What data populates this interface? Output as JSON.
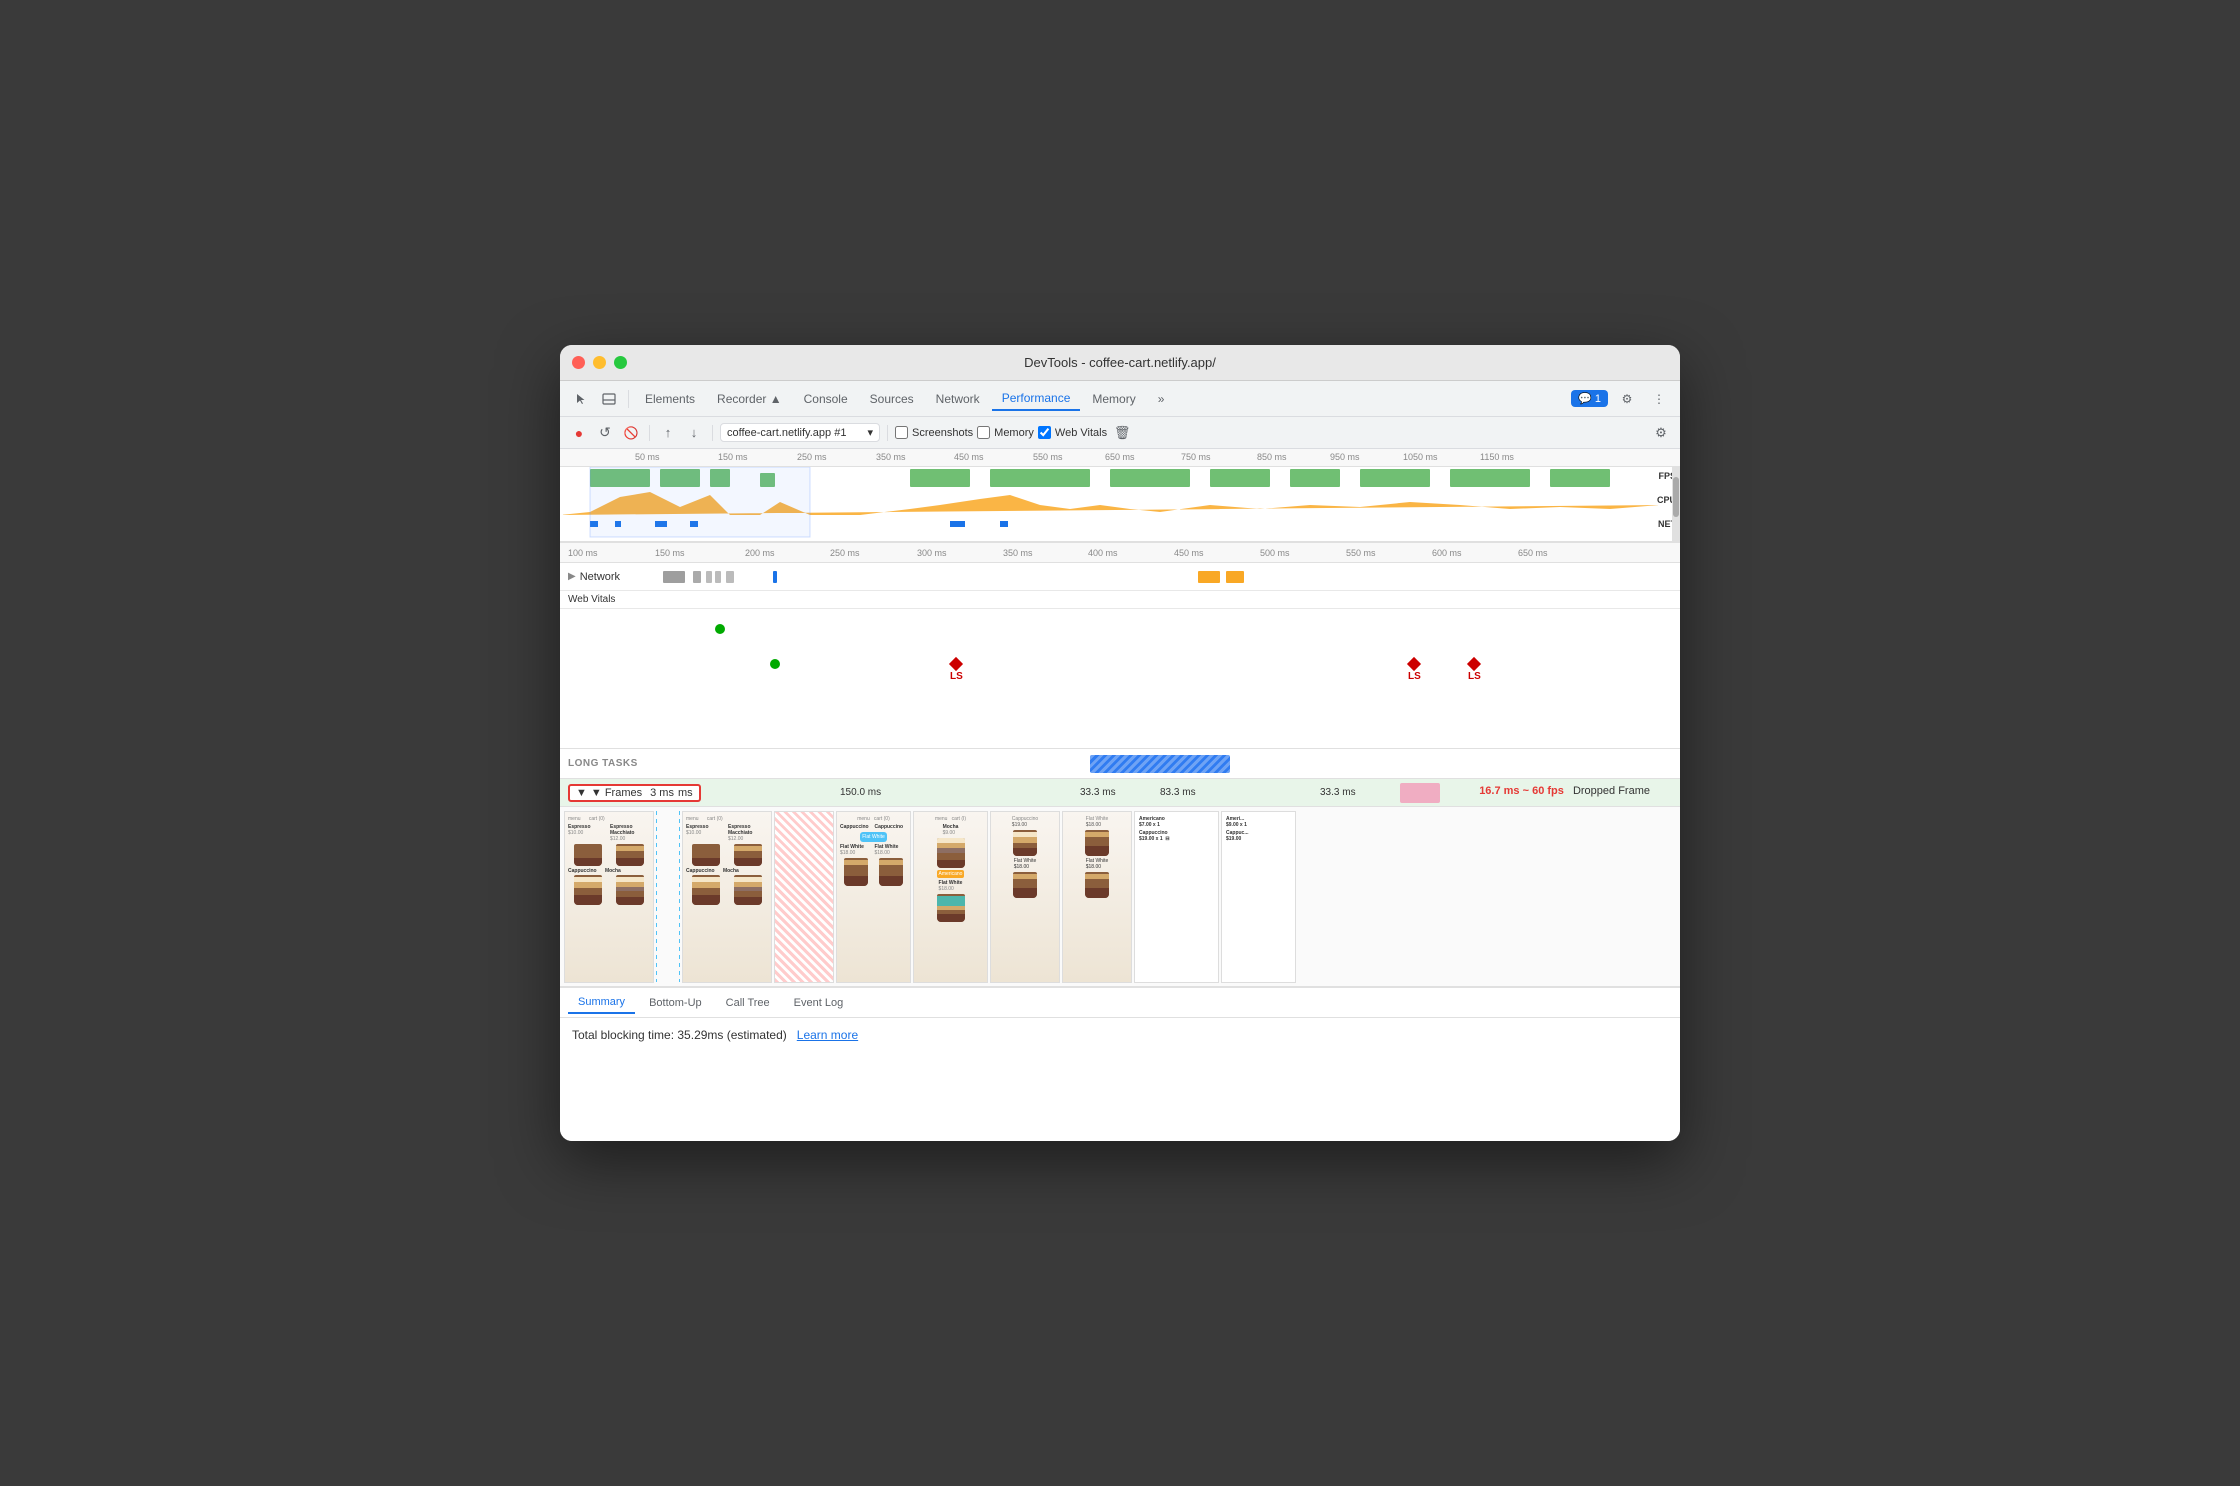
{
  "window": {
    "title": "DevTools - coffee-cart.netlify.app/"
  },
  "tabs": {
    "items": [
      {
        "label": "Elements",
        "active": false
      },
      {
        "label": "Recorder ▲",
        "active": false
      },
      {
        "label": "Console",
        "active": false
      },
      {
        "label": "Sources",
        "active": false
      },
      {
        "label": "Network",
        "active": false
      },
      {
        "label": "Performance",
        "active": true
      },
      {
        "label": "Memory",
        "active": false
      }
    ],
    "more": "»",
    "chat_badge": "1",
    "settings_icon": "⚙",
    "menu_icon": "⋮"
  },
  "toolbar": {
    "record_label": "●",
    "reload_label": "↺",
    "clear_label": "🚫",
    "upload_label": "↑",
    "download_label": "↓",
    "url": "coffee-cart.netlify.app #1",
    "screenshots_label": "Screenshots",
    "memory_label": "Memory",
    "web_vitals_label": "Web Vitals",
    "trash_label": "🗑",
    "settings_label": "⚙"
  },
  "overview": {
    "ruler_ticks": [
      "50 ms",
      "150 ms",
      "250 ms",
      "350 ms",
      "450 ms",
      "550 ms",
      "650 ms",
      "750 ms",
      "850 ms",
      "950 ms",
      "1050 ms",
      "1150 ms"
    ],
    "fps_label": "FPS",
    "cpu_label": "CPU",
    "net_label": "NET"
  },
  "timeline": {
    "ruler_ticks": [
      "100 ms",
      "150 ms",
      "200 ms",
      "250 ms",
      "300 ms",
      "350 ms",
      "400 ms",
      "450 ms",
      "500 ms",
      "550 ms",
      "600 ms",
      "650 ms"
    ],
    "network_label": "Network",
    "web_vitals_label": "Web Vitals",
    "long_tasks_label": "LONG TASKS",
    "frames_label": "▼ Frames",
    "frames_ms": "3 ms"
  },
  "frames": {
    "times": [
      "150.0 ms",
      "33.3 ms",
      "83.3 ms",
      "33.3 ms"
    ],
    "dropped_text": "16.7 ms ~ 60 fps",
    "dropped_label": "Dropped Frame"
  },
  "ls_markers": [
    {
      "label": "LS",
      "position": 53
    },
    {
      "label": "LS",
      "position": 89
    },
    {
      "label": "LS",
      "position": 96
    }
  ],
  "summary": {
    "tabs": [
      "Summary",
      "Bottom-Up",
      "Call Tree",
      "Event Log"
    ],
    "active_tab": "Summary",
    "blocking_time_text": "Total blocking time: 35.29ms (estimated)",
    "learn_more_label": "Learn more"
  }
}
